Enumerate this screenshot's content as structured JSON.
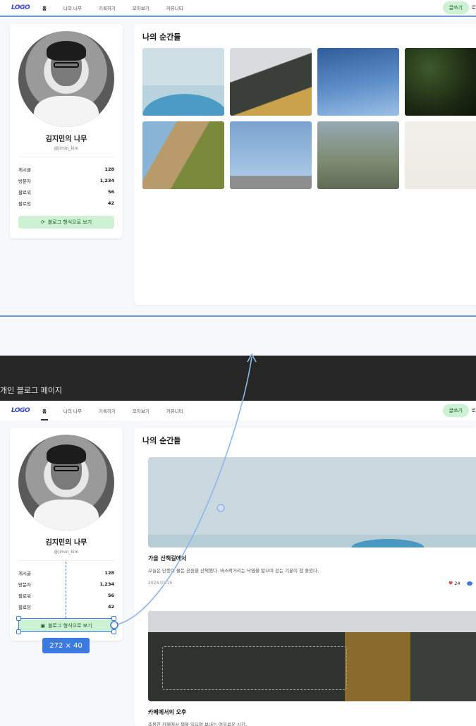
{
  "nav": {
    "logo": "LOGO",
    "items": [
      {
        "label": "홈"
      },
      {
        "label": "나의 나무"
      },
      {
        "label": "기록하기"
      },
      {
        "label": "모아보기"
      },
      {
        "label": "커뮤니티"
      }
    ],
    "write_label": "글쓰기",
    "cut_label": "로"
  },
  "profile": {
    "name": "김지민의 나무",
    "handle": "@jimin_kim",
    "stats": [
      {
        "label": "게시글",
        "value": "128"
      },
      {
        "label": "방문자",
        "value": "1,234"
      },
      {
        "label": "팔로워",
        "value": "56"
      },
      {
        "label": "팔로잉",
        "value": "42"
      }
    ],
    "blog_button": "블로그 형식으로 보기"
  },
  "moments": {
    "title": "나의 순간들"
  },
  "section_label": "개인 블로그 페이지",
  "posts": [
    {
      "title": "가을 산책길에서",
      "desc": "오늘은 단풍이 물든 공원을 산책했다. 바스락거리는 낙엽을 밟으며 걷는 기분이 참 좋았다.",
      "date": "2024.01.15",
      "likes": "24"
    },
    {
      "title": "카페에서의 오후",
      "desc": "조용한 카페에서 책을 읽으며 보내는 여유로운 시간."
    }
  ],
  "selection": {
    "size_label": "272 × 40"
  },
  "colors": {
    "accent": "#3d7ae0",
    "button_bg": "#cdf1d3",
    "logo": "#3a47c8"
  }
}
